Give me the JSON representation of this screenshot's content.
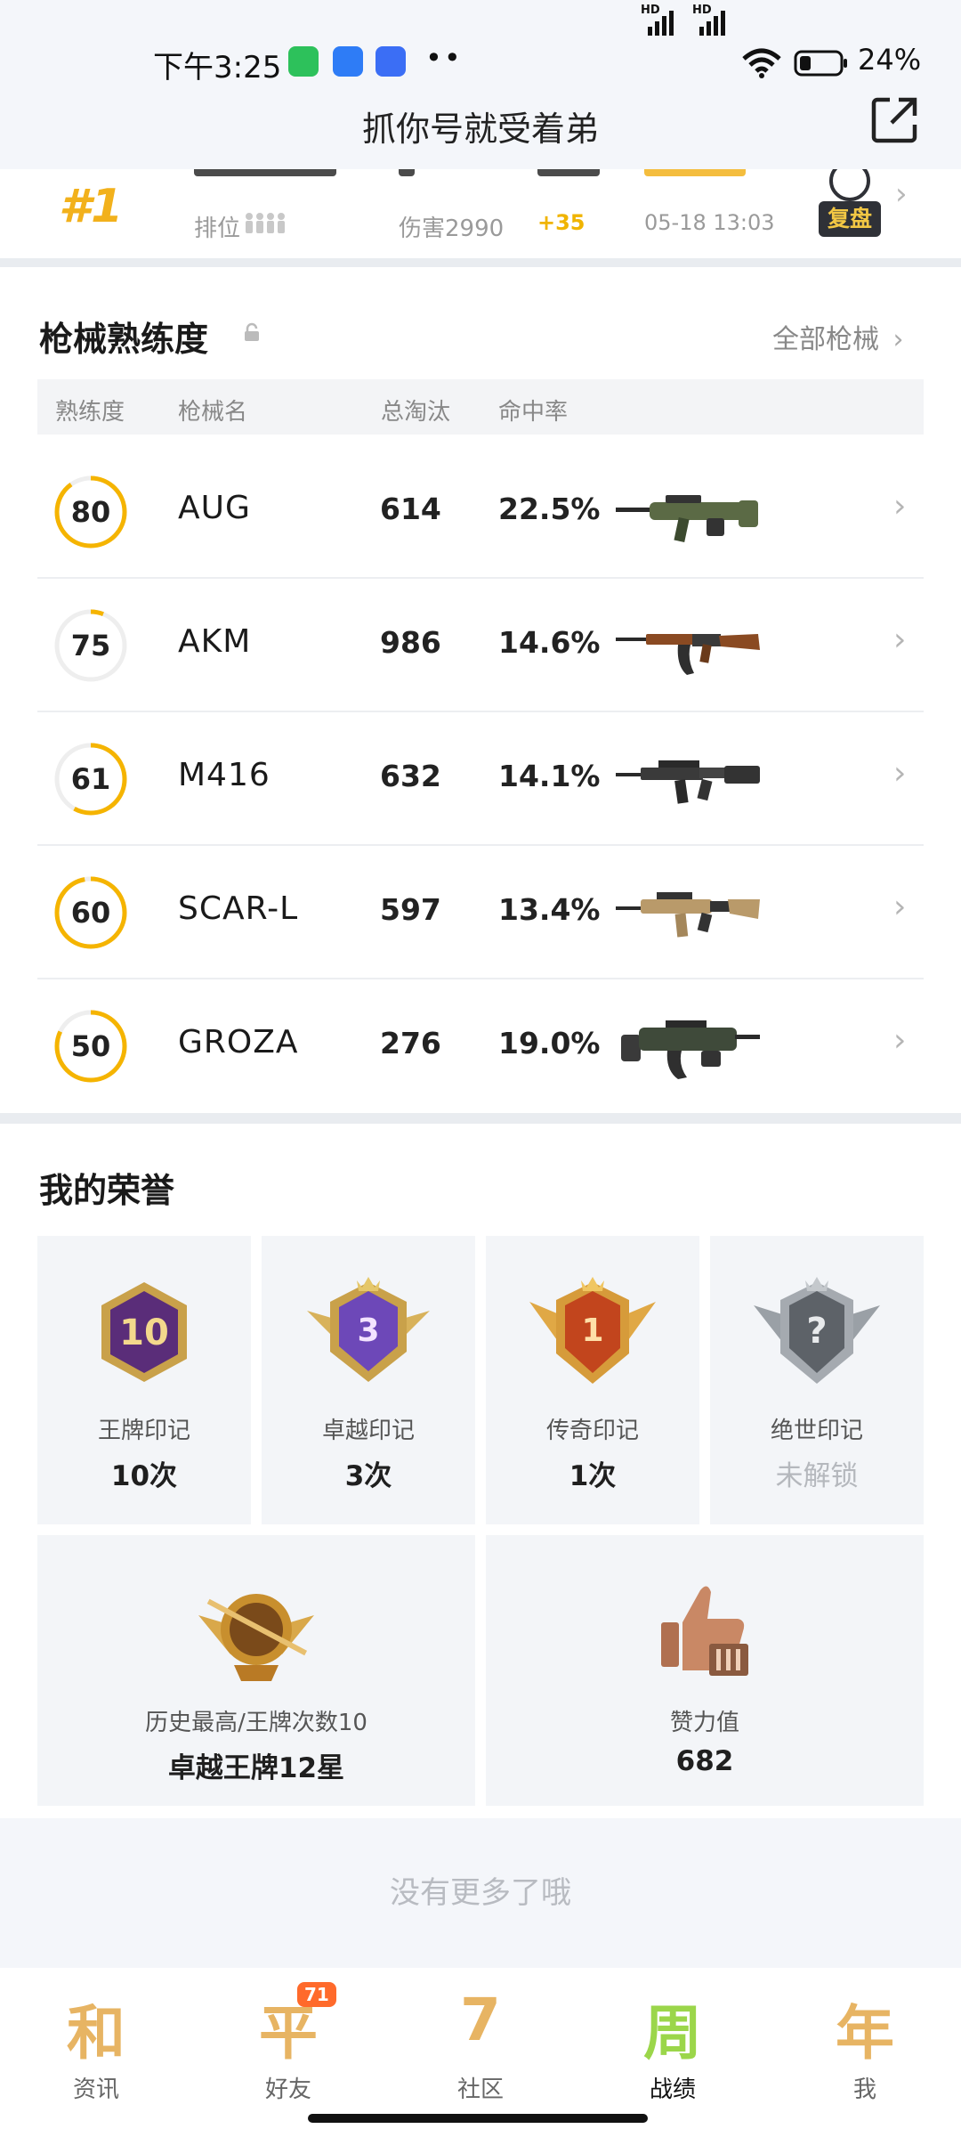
{
  "status_bar": {
    "time": "下午3:25",
    "dots": "••",
    "battery_percent": "24%",
    "signal": [
      "HD",
      "HD"
    ]
  },
  "header": {
    "title": "抓你号就受着弟",
    "share_icon": "share-icon"
  },
  "match": {
    "rank": "#1",
    "rank_label": "排位",
    "damage": "伤害2990",
    "score_delta": "+35",
    "datetime": "05-18 13:03",
    "replay_label": "复盘"
  },
  "weapons": {
    "title": "枪械熟练度",
    "all_link": "全部枪械",
    "headers": {
      "proficiency": "熟练度",
      "name": "枪械名",
      "kills": "总淘汰",
      "accuracy": "命中率"
    },
    "rows": [
      {
        "proficiency": "80",
        "progress": 0.9,
        "name": "AUG",
        "kills": "614",
        "accuracy": "22.5%"
      },
      {
        "proficiency": "75",
        "progress": 0.06,
        "name": "AKM",
        "kills": "986",
        "accuracy": "14.6%"
      },
      {
        "proficiency": "61",
        "progress": 0.58,
        "name": "M416",
        "kills": "632",
        "accuracy": "14.1%"
      },
      {
        "proficiency": "60",
        "progress": 0.97,
        "name": "SCAR-L",
        "kills": "597",
        "accuracy": "13.4%"
      },
      {
        "proficiency": "50",
        "progress": 0.82,
        "name": "GROZA",
        "kills": "276",
        "accuracy": "19.0%"
      }
    ]
  },
  "honors": {
    "title": "我的荣誉",
    "badges": [
      {
        "label": "王牌印记",
        "value": "10次",
        "emblem": "10",
        "locked": false
      },
      {
        "label": "卓越印记",
        "value": "3次",
        "emblem": "3",
        "locked": false
      },
      {
        "label": "传奇印记",
        "value": "1次",
        "emblem": "1",
        "locked": false
      },
      {
        "label": "绝世印记",
        "value": "未解锁",
        "emblem": "?",
        "locked": true
      }
    ],
    "highest": {
      "label": "历史最高/王牌次数10",
      "value": "卓越王牌12星"
    },
    "likes": {
      "label": "赞力值",
      "value": "682"
    }
  },
  "footer_text": "没有更多了哦",
  "nav": {
    "items": [
      {
        "label": "资讯",
        "glyph": "和"
      },
      {
        "label": "好友",
        "glyph": "平",
        "badge": "71"
      },
      {
        "label": "社区",
        "glyph": "7"
      },
      {
        "label": "战绩",
        "glyph": "周"
      },
      {
        "label": "我",
        "glyph": "年"
      }
    ],
    "active_index": 3
  },
  "colors": {
    "accent_gold": "#f2b11c",
    "ring_track": "#eeeeee",
    "ring_fill": "#f5b400"
  }
}
